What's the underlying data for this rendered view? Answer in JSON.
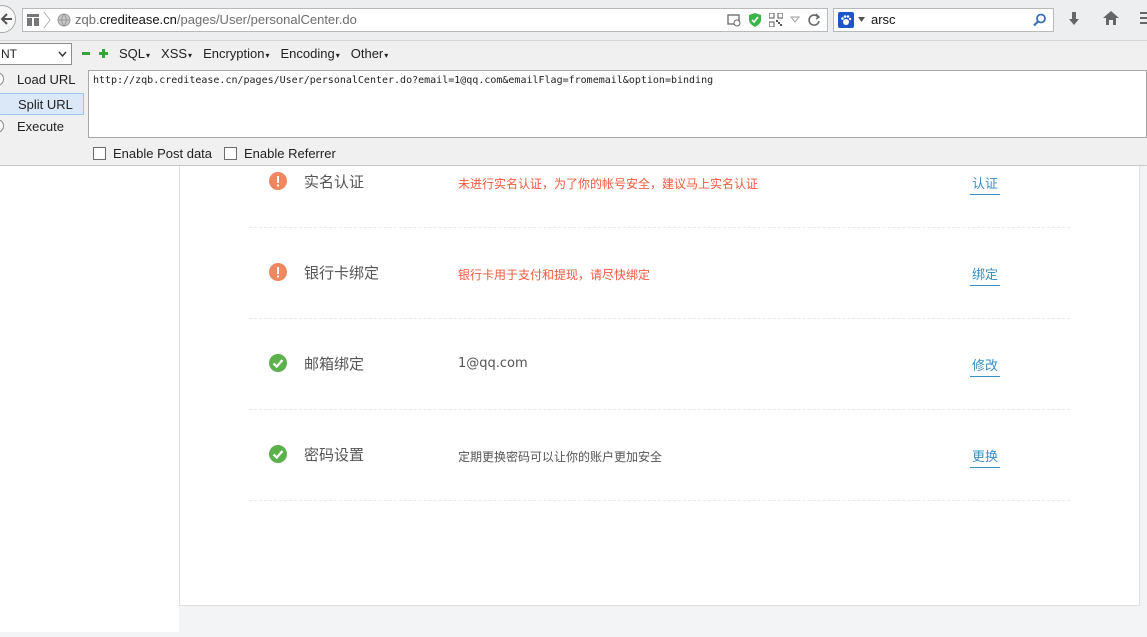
{
  "browser": {
    "url_prefix": "zqb.",
    "url_host": "creditease.cn",
    "url_path": "/pages/User/personalCenter.do",
    "search_text": "arsc"
  },
  "hackbar": {
    "select_value": "NT",
    "menus": [
      "SQL",
      "XSS",
      "Encryption",
      "Encoding",
      "Other"
    ],
    "buttons": [
      "Load URL",
      "Split URL",
      "Execute"
    ],
    "textarea": "http://zqb.creditease.cn/pages/User/personalCenter.do?email=1@qq.com&emailFlag=fromemail&option=binding",
    "enable_post_label": "Enable Post data",
    "enable_referrer_label": "Enable Referrer"
  },
  "security_items": [
    {
      "title": "实名认证",
      "desc": "未进行实名认证，为了你的帐号安全，建议马上实名认证",
      "action": "认证",
      "status": "warning"
    },
    {
      "title": "银行卡绑定",
      "desc": "银行卡用于支付和提现，请尽快绑定",
      "action": "绑定",
      "status": "warning"
    },
    {
      "title": "邮箱绑定",
      "desc": "1@qq.com",
      "action": "修改",
      "status": "ok"
    },
    {
      "title": "密码设置",
      "desc": "定期更换密码可以让你的账户更加安全",
      "action": "更换",
      "status": "ok"
    }
  ],
  "colors": {
    "warning": "#f0875e",
    "ok": "#5db14d",
    "link": "#3a8fc6",
    "warning_text": "#f05a3c"
  }
}
